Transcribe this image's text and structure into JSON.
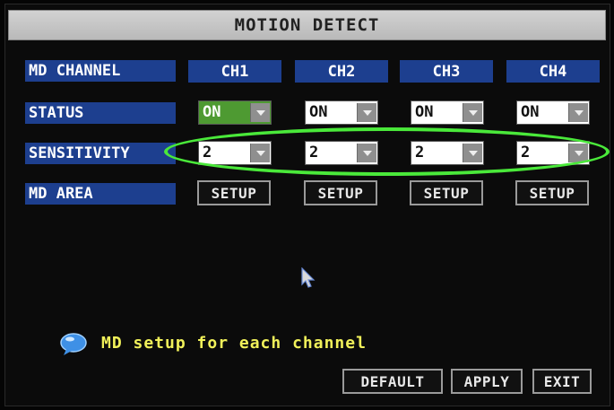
{
  "title": "MOTION DETECT",
  "rows": {
    "md_channel": "MD CHANNEL",
    "status": "STATUS",
    "sensitivity": "SENSITIVITY",
    "md_area": "MD AREA"
  },
  "channels": [
    {
      "label": "CH1",
      "status": "ON",
      "sensitivity": "2",
      "area": "SETUP"
    },
    {
      "label": "CH2",
      "status": "ON",
      "sensitivity": "2",
      "area": "SETUP"
    },
    {
      "label": "CH3",
      "status": "ON",
      "sensitivity": "2",
      "area": "SETUP"
    },
    {
      "label": "CH4",
      "status": "ON",
      "sensitivity": "2",
      "area": "SETUP"
    }
  ],
  "hint": "MD setup for each channel",
  "buttons": {
    "default": "DEFAULT",
    "apply": "APPLY",
    "exit": "EXIT"
  },
  "colors": {
    "title_bg": "#c4c4c4",
    "label_bg": "#1d3f8f",
    "active": "#4e9a32",
    "highlight": "#4ae93a",
    "hint_text": "#f1f15a"
  },
  "icons": {
    "hint": "info-bubble-icon",
    "cursor": "mouse-pointer-icon",
    "dropdown": "chevron-down-icon"
  }
}
